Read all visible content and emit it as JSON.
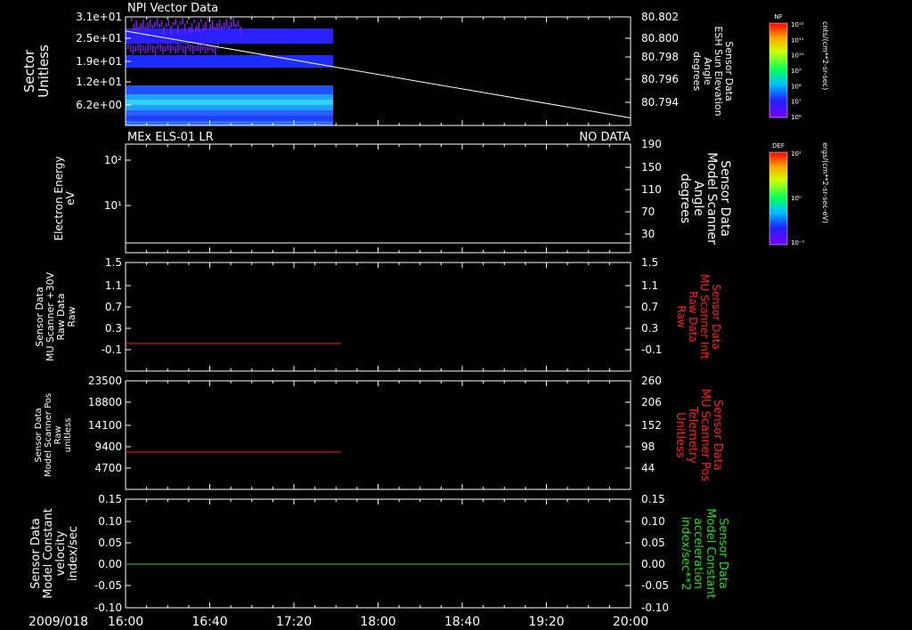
{
  "date_label": "2009/018",
  "time_axis": {
    "ticks": [
      "16:00",
      "16:40",
      "17:20",
      "18:00",
      "18:40",
      "19:20",
      "20:00"
    ],
    "range_hours": [
      16,
      20
    ]
  },
  "panels": [
    {
      "id": "p1",
      "top_left_title": "NPI Vector Data",
      "top_right_title": "",
      "left_label": [
        "Sector",
        "Unitless"
      ],
      "right_label": [
        "Sensor Data",
        "ESH Sun Elevation",
        "Angle",
        "degrees"
      ],
      "left_ticks": [
        "3.1e+01",
        "2.5e+01",
        "1.9e+01",
        "1.2e+01",
        "6.2e+00"
      ],
      "right_ticks": [
        "80.802",
        "80.800",
        "80.798",
        "80.796",
        "80.794"
      ]
    },
    {
      "id": "p2",
      "top_left_title": "MEx ELS-01 LR",
      "top_right_title": "NO DATA",
      "left_label": [
        "Electron Energy",
        "eV"
      ],
      "right_label": [
        "Sensor Data",
        "Model Scanner",
        "Angle",
        "degrees"
      ],
      "left_ticks": [
        "10²",
        "10¹"
      ],
      "right_ticks": [
        "190",
        "150",
        "110",
        "70",
        "30"
      ]
    },
    {
      "id": "p3",
      "top_left_title": "",
      "top_right_title": "",
      "left_label": [
        "Sensor Data",
        "MU Scanner +30V",
        "Raw Data",
        "Raw"
      ],
      "right_label": [
        "Sensor Data",
        "MU Scanner Inft",
        "Raw Data",
        "Raw"
      ],
      "left_ticks": [
        "1.5",
        "1.1",
        "0.7",
        "0.3",
        "-0.1"
      ],
      "right_ticks": [
        "1.5",
        "1.1",
        "0.7",
        "0.3",
        "-0.1"
      ]
    },
    {
      "id": "p4",
      "top_left_title": "",
      "top_right_title": "",
      "left_label": [
        "Sensor Data",
        "Model Scanner Pos",
        "Raw",
        "unitless"
      ],
      "right_label": [
        "Sensor Data",
        "MU Scanner Pos",
        "Telemetry",
        "Unitless"
      ],
      "left_ticks": [
        "23500",
        "18800",
        "14100",
        "9400",
        "4700"
      ],
      "right_ticks": [
        "260",
        "206",
        "152",
        "98",
        "44"
      ]
    },
    {
      "id": "p5",
      "top_left_title": "",
      "top_right_title": "",
      "left_label": [
        "Sensor Data",
        "Model Constant",
        "velocity",
        "index/sec"
      ],
      "right_label": [
        "Sensor Data",
        "Model Constant",
        "acceleration",
        "index/sec**2"
      ],
      "left_ticks": [
        "0.15",
        "0.10",
        "0.05",
        "0.00",
        "-0.05",
        "-0.10"
      ],
      "right_ticks": [
        "0.15",
        "0.10",
        "0.05",
        "0.00",
        "-0.05",
        "-0.10"
      ]
    }
  ],
  "colorbars": [
    {
      "label": "NF",
      "unit": "cnts/(cm**2-sr-sec)",
      "ticks": [
        "10¹²",
        "10¹¹",
        "10¹⁰",
        "10⁹",
        "10⁸",
        "10⁷",
        "10⁶"
      ]
    },
    {
      "label": "DEF",
      "unit": "ergs/(cm**2-sr-sec-eV)",
      "ticks": [
        "10¹",
        "10⁰",
        "10⁻¹"
      ]
    }
  ],
  "colors": {
    "background": "#000000",
    "axis": "#ffffff",
    "red_trace": "#ff2020",
    "green_trace": "#22dd22",
    "spectro_purple": "#6a1fe0",
    "spectro_blue": "#2030ff",
    "spectro_cyan": "#20b0ff"
  },
  "chart_data": [
    {
      "type": "heatmap",
      "panel": "p1",
      "description_source": "NPI Vector Data spectrogram",
      "x_range": [
        "16:00",
        "20:00"
      ],
      "data_extent_x": [
        "16:00",
        "17:37"
      ],
      "ylim_left": [
        0,
        31
      ],
      "y_scale_left": "linear",
      "line_series": {
        "axis": "right",
        "ylim": [
          80.7925,
          80.8025
        ],
        "x": [
          "16:00",
          "20:00"
        ],
        "y": [
          80.8012,
          80.7932
        ]
      }
    },
    {
      "type": "line",
      "panel": "p2",
      "y_scale_left": "log",
      "ylim_right": [
        0,
        190
      ],
      "series": [
        {
          "axis": "right",
          "x": [
            "16:00",
            "20:00"
          ],
          "y": [
            10,
            10
          ]
        }
      ]
    },
    {
      "type": "line",
      "panel": "p3",
      "ylim": [
        -0.3,
        1.5
      ],
      "series": [
        {
          "color": "red",
          "x": [
            "16:00",
            "17:37"
          ],
          "y": [
            0.0,
            0.0
          ]
        }
      ]
    },
    {
      "type": "line",
      "panel": "p4",
      "ylim_left": [
        0,
        23500
      ],
      "series": [
        {
          "color": "red",
          "x": [
            "16:00",
            "17:37"
          ],
          "y": [
            8400,
            8400
          ]
        }
      ]
    },
    {
      "type": "line",
      "panel": "p5",
      "ylim": [
        -0.1,
        0.15
      ],
      "series": [
        {
          "color": "green",
          "x": [
            "16:00",
            "20:00"
          ],
          "y": [
            0.0,
            0.0
          ]
        }
      ]
    }
  ]
}
